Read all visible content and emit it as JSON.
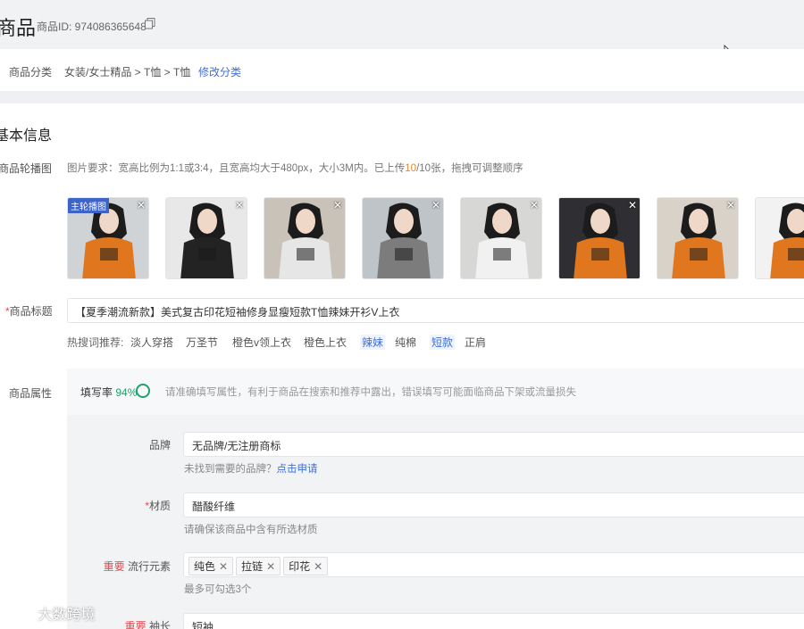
{
  "header": {
    "title": "商品",
    "product_id": "商品ID: 974086365648",
    "copy_icon": "copy-icon"
  },
  "category": {
    "label": "商品分类",
    "path": "女装/女士精品 > T恤 > T恤",
    "edit": "修改分类"
  },
  "basic": {
    "title": "基本信息",
    "carousel_label": "商品轮播图",
    "carousel_hint_pre": "图片要求：宽高比例为1:1或3:4，且宽高均大于480px，大小3M内。已上传",
    "carousel_count": "10",
    "carousel_hint_post": "/10张，拖拽可调整顺序",
    "main_image_tag": "主轮播图",
    "images": [
      {
        "close": "✕",
        "shirt": "#e0771f",
        "bg": "#cfd3d6"
      },
      {
        "close": "✕",
        "shirt": "#232323",
        "bg": "#e8e8e8"
      },
      {
        "close": "✕",
        "shirt": "#e6e6e6",
        "bg": "#c8c2b8"
      },
      {
        "close": "✕",
        "shirt": "#7c7c7c",
        "bg": "#bfc4c8"
      },
      {
        "close": "✕",
        "shirt": "#f1f1f1",
        "bg": "#d7d7d5"
      },
      {
        "close": "✕",
        "shirt": "#e0771f",
        "bg": "#2f2f33"
      },
      {
        "close": "✕",
        "shirt": "#e0771f",
        "bg": "#d9d2c9"
      },
      {
        "close": "",
        "shirt": "#e0771f",
        "bg": "#f2f2f2"
      }
    ]
  },
  "product_title": {
    "label": "商品标题",
    "value": "【夏季潮流新款】美式复古印花短袖修身显瘦短款T恤辣妹开衫V上衣"
  },
  "hot_words": {
    "label": "热搜词推荐:",
    "items": [
      "淡人穿搭",
      "万圣节",
      "橙色v领上衣",
      "橙色上衣",
      "辣妹",
      "纯棉",
      "短款",
      "正肩"
    ]
  },
  "attributes": {
    "label": "商品属性",
    "fill_rate_label": "填写率",
    "fill_rate": "94%",
    "tip": "请准确填写属性，有利于商品在搜索和推荐中露出，错误填写可能面临商品下架或流量损失",
    "brand": {
      "label": "品牌",
      "value": "无品牌/无注册商标",
      "hint": "未找到需要的品牌？",
      "hint_link": "点击申请"
    },
    "material": {
      "label": "材质",
      "value": "醋酸纤维",
      "hint": "请确保该商品中含有所选材质"
    },
    "style": {
      "important": "重要",
      "label": "流行元素",
      "tags": [
        "纯色",
        "拉链",
        "印花"
      ],
      "remove": "✕",
      "hint": "最多可勾选3个"
    },
    "sleeve": {
      "important": "重要",
      "label": "袖长",
      "value": "短袖"
    }
  },
  "watermark": "大数跨境",
  "colors": {
    "accent": "#3f6fd6",
    "success": "#22a06b",
    "required": "#e5484d",
    "highlight": "#e08a2b"
  }
}
